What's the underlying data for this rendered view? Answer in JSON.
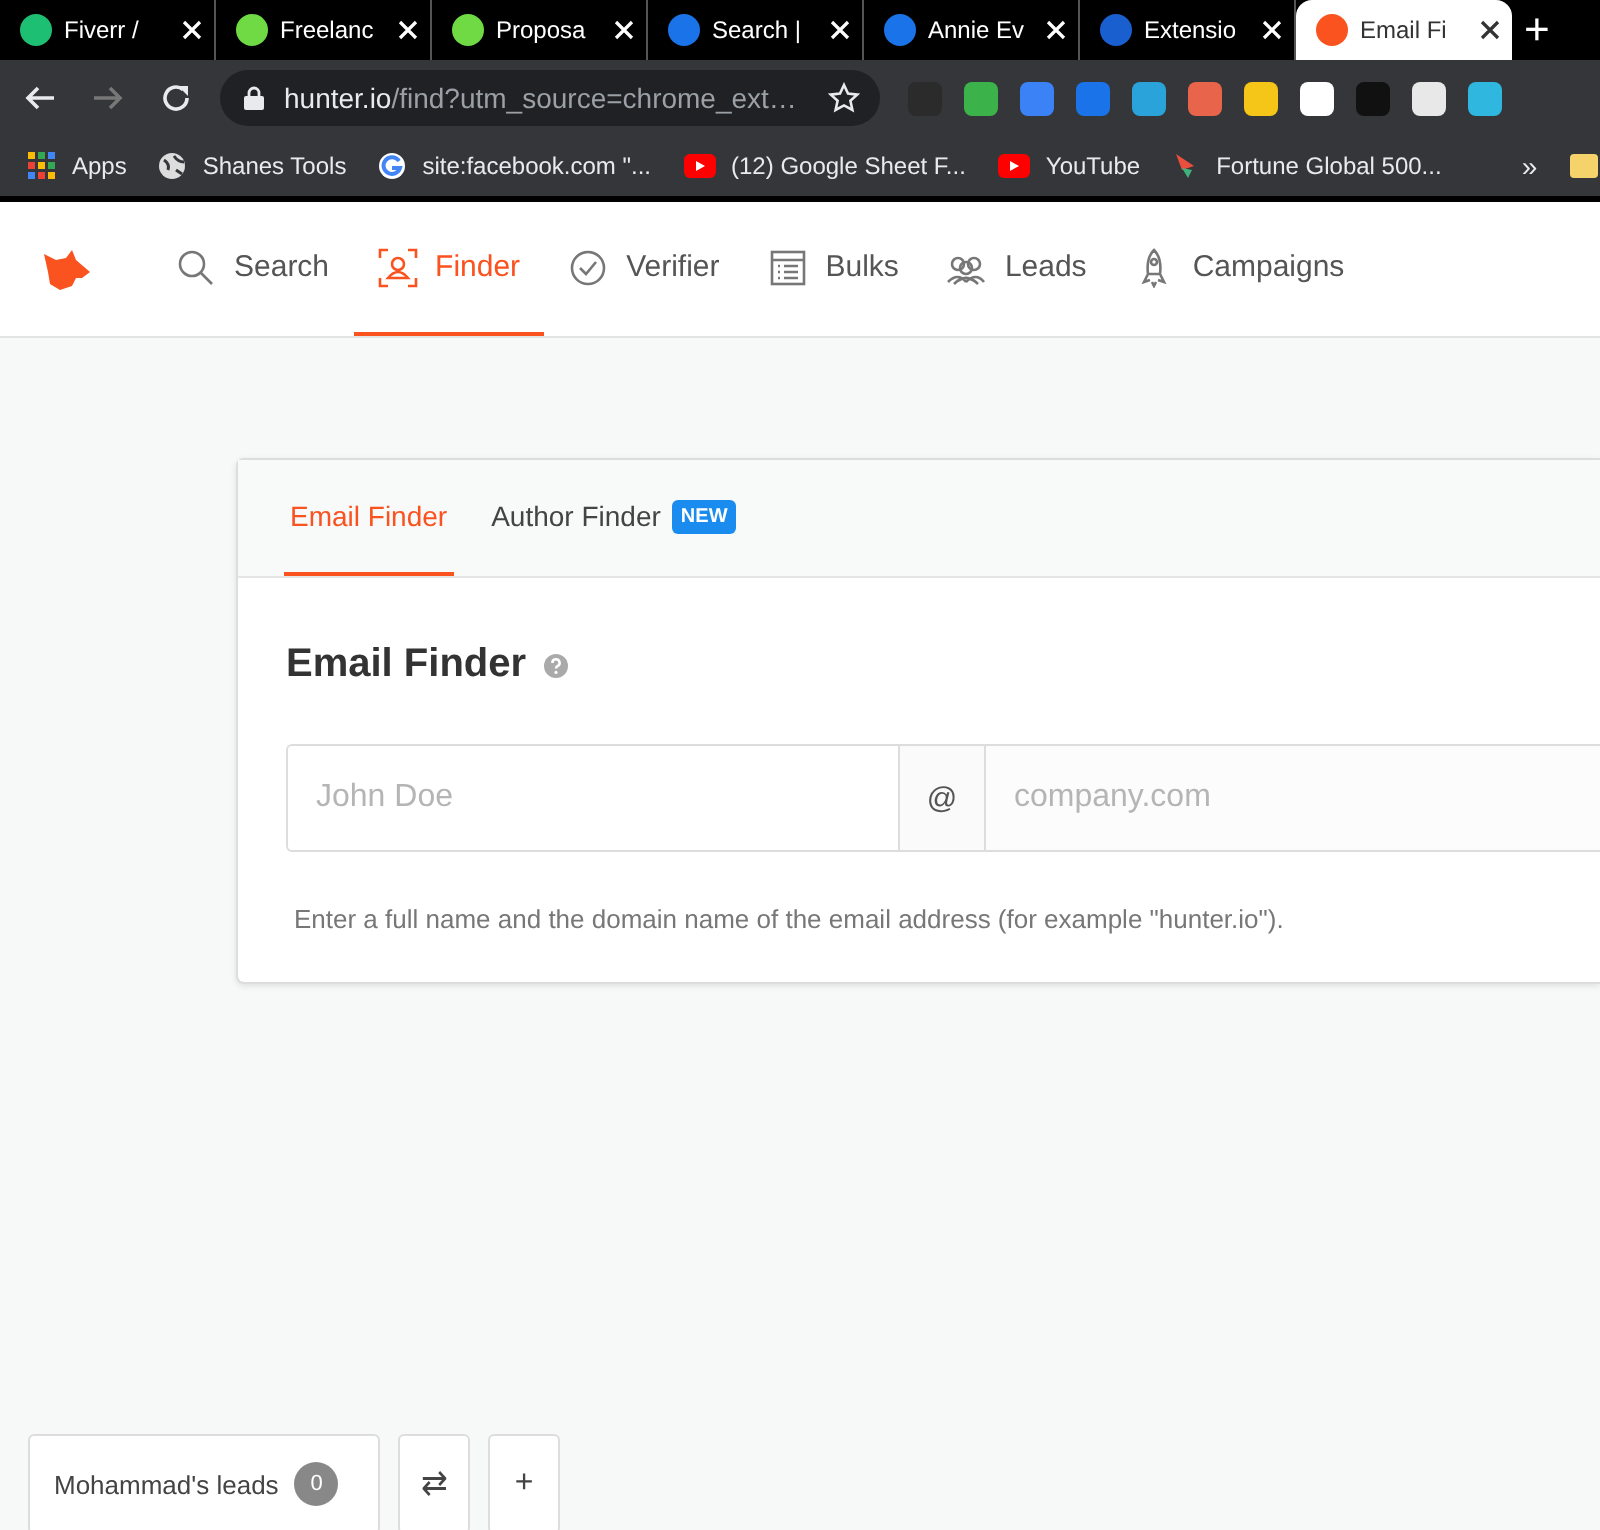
{
  "browser_tabs": [
    {
      "title": "Fiverr /",
      "selected": false
    },
    {
      "title": "Freelanc",
      "selected": false
    },
    {
      "title": "Proposa",
      "selected": false
    },
    {
      "title": "Search |",
      "selected": false
    },
    {
      "title": "Annie Ev",
      "selected": false
    },
    {
      "title": "Extensio",
      "selected": false
    },
    {
      "title": "Email Fi",
      "selected": true
    }
  ],
  "new_tab": "+",
  "address_bar": {
    "host": "hunter.io",
    "path": "/find?utm_source=chrome_ext…"
  },
  "bookmarks": [
    "Apps",
    "Shanes Tools",
    "site:facebook.com \"...",
    "(12) Google Sheet F...",
    "YouTube",
    "Fortune Global 500..."
  ],
  "bookmarks_more": "»",
  "nav": [
    {
      "label": "Search",
      "selected": false
    },
    {
      "label": "Finder",
      "selected": true
    },
    {
      "label": "Verifier",
      "selected": false
    },
    {
      "label": "Bulks",
      "selected": false
    },
    {
      "label": "Leads",
      "selected": false
    },
    {
      "label": "Campaigns",
      "selected": false
    }
  ],
  "card": {
    "tabs": [
      {
        "label": "Email Finder",
        "selected": true
      },
      {
        "label": "Author Finder",
        "selected": false,
        "badge": "NEW"
      }
    ],
    "title": "Email Finder",
    "name_field": {
      "placeholder": "John Doe"
    },
    "at": "@",
    "domain_field": {
      "placeholder": "company.com"
    },
    "help": "Enter a full name and the domain name of the email address (for example \"hunter.io\")."
  },
  "leads_bar": {
    "label": "Mohammad's leads",
    "count": "0",
    "switch": "⇄",
    "add": "+"
  }
}
